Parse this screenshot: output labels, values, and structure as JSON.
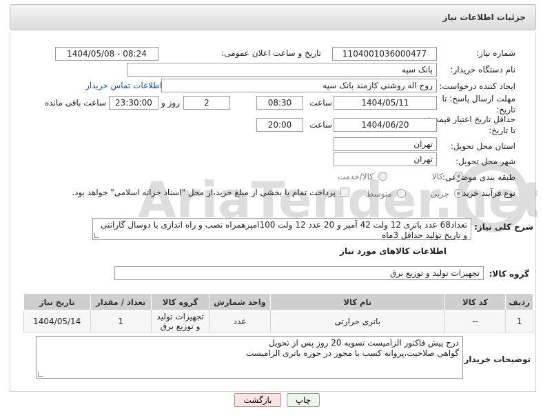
{
  "header": {
    "title": "جزئیات اطلاعات نیاز"
  },
  "fields": {
    "need_number_label": "شماره نیاز:",
    "need_number": "1104001036000477",
    "announce_label": "تاریخ و ساعت اعلان عمومی:",
    "announce_value": "1404/05/08 - 08:24",
    "buyer_org_label": "نام دستگاه خریدار:",
    "buyer_org": "بانک سپه",
    "creator_label": "ایجاد کننده درخواست:",
    "creator": "روح اله روشنی کارمند بانک سپه",
    "contact_link": "اطلاعات تماس خریدار",
    "deadline_label_1": "مهلت ارسال پاسخ: تا",
    "deadline_label_2": "تاریخ:",
    "deadline_date": "1404/05/11",
    "time_label": "ساعت",
    "deadline_time": "08:30",
    "days_value": "2",
    "days_label": "روز و",
    "remaining_time": "23:30:00",
    "remaining_label": "ساعت باقی مانده",
    "validity_label_1": "حداقل تاریخ اعتبار قیمت:",
    "validity_label_2": "تا تاریخ:",
    "validity_date": "1404/06/20",
    "validity_time_label": "ساعت",
    "validity_time": "20:00",
    "province_label": "استان محل تحویل:",
    "province": "تهران",
    "city_label": "شهر محل تحویل:",
    "city": "تهران",
    "category_label": "طبقه بندی موضوعی:",
    "category_goods": "کالا",
    "category_goods_service": "کالا/خدمت",
    "process_label": "نوع فرآیند خرید :",
    "process_partial": "جزیی",
    "process_medium": "متوسط",
    "payment_note": "پرداخت تمام یا بخشی از مبلغ خرید،از محل \"اسناد خزانه اسلامی\" خواهد بود."
  },
  "description": {
    "label": "شرح کلی نیاز:",
    "text": "تعداد68 عدد باتری 12 ولت 42 آمپر و 20 عدد 12 ولت 100امپرهمراه نصب و راه اندازی با دوسال گارانتی و تاریخ تولید حداقل 3ماه"
  },
  "goods_section": {
    "title": "اطلاعات کالاهای مورد نیاز",
    "group_label": "گروه کالا:",
    "group_value": "تجهیزات تولید و توزیع برق"
  },
  "table": {
    "headers": [
      "ردیف",
      "کد کالا",
      "نام کالا",
      "واحد شمارش",
      "گروه کالا",
      "تعداد / مقدار",
      "تاریخ نیاز"
    ],
    "rows": [
      [
        "1",
        "--",
        "باتری حرارتی",
        "عدد",
        "تجهیزات تولید و توزیع برق",
        "1",
        "1404/05/14"
      ]
    ]
  },
  "buyer_notes": {
    "label": "توضیحات خریدار:",
    "line1": "درج پیش فاکتور الزامیست تسویه 20 روز پس از تحویل",
    "line2": "گواهی صلاحیت،پروانه کسب یا مجوز در حوزه باتری الزامیست"
  },
  "buttons": {
    "print": "چاپ",
    "back": "بازگشت"
  },
  "colors": {
    "link": "#1a4fa0",
    "back_button": "#fde3e3",
    "print_button": "#eef6e8"
  },
  "watermark": {
    "brand": "AriaTender.net"
  }
}
